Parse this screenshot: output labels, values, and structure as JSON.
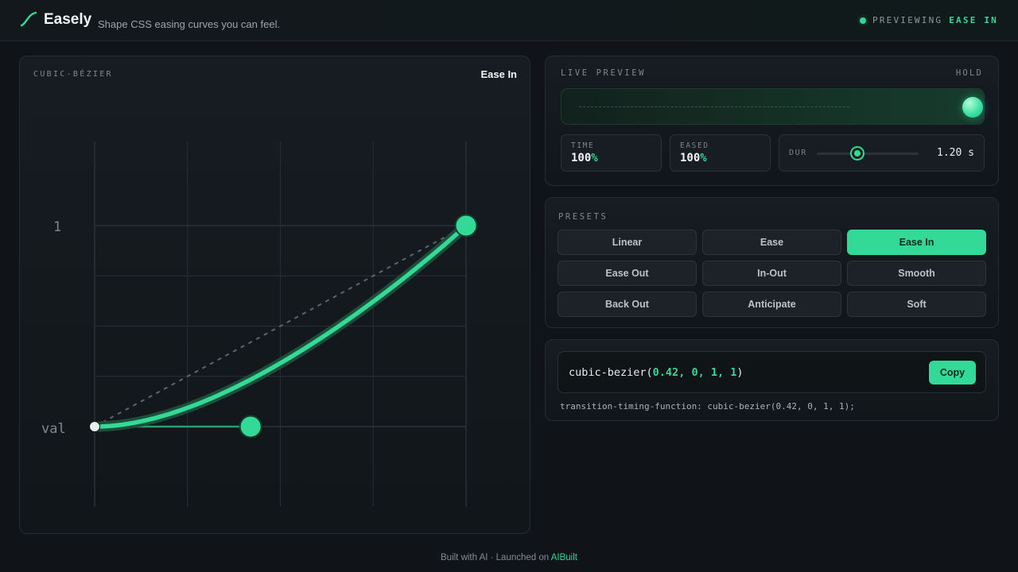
{
  "header": {
    "brand": "Easely",
    "tagline": "Shape CSS easing curves you can feel.",
    "status_label": "PREVIEWING",
    "status_value": "EASE IN"
  },
  "editor": {
    "title": "CUBIC-BÉZIER",
    "preset_name": "Ease In",
    "axis_label_top": "1",
    "axis_label_left": "val",
    "bezier": [
      0.42,
      0,
      1,
      1
    ]
  },
  "live_preview": {
    "title": "LIVE PREVIEW",
    "hold_label": "HOLD",
    "progress": 1.0,
    "time_label": "TIME",
    "time_value": "100",
    "eased_label": "EASED",
    "eased_value": "100",
    "percent_sign": "%",
    "duration_label": "DUR",
    "duration_value": "1.20 s",
    "duration_fraction": 0.4
  },
  "presets": {
    "title": "PRESETS",
    "items": [
      {
        "label": "Linear",
        "active": false
      },
      {
        "label": "Ease",
        "active": false
      },
      {
        "label": "Ease In",
        "active": true
      },
      {
        "label": "Ease Out",
        "active": false
      },
      {
        "label": "In-Out",
        "active": false
      },
      {
        "label": "Smooth",
        "active": false
      },
      {
        "label": "Back Out",
        "active": false
      },
      {
        "label": "Anticipate",
        "active": false
      },
      {
        "label": "Soft",
        "active": false
      }
    ]
  },
  "code": {
    "fn_open": "cubic-bezier(",
    "p1": "0.42",
    "p2": "0",
    "p3": "1",
    "p4": "1",
    "sep": ", ",
    "fn_close": ")",
    "copy_label": "Copy",
    "css_line": "transition-timing-function: cubic-bezier(0.42, 0, 1, 1);"
  },
  "footer": {
    "text": "Built with AI · Launched on ",
    "link": "AIBuilt"
  },
  "colors": {
    "accent": "#33d997",
    "background": "#101418"
  }
}
